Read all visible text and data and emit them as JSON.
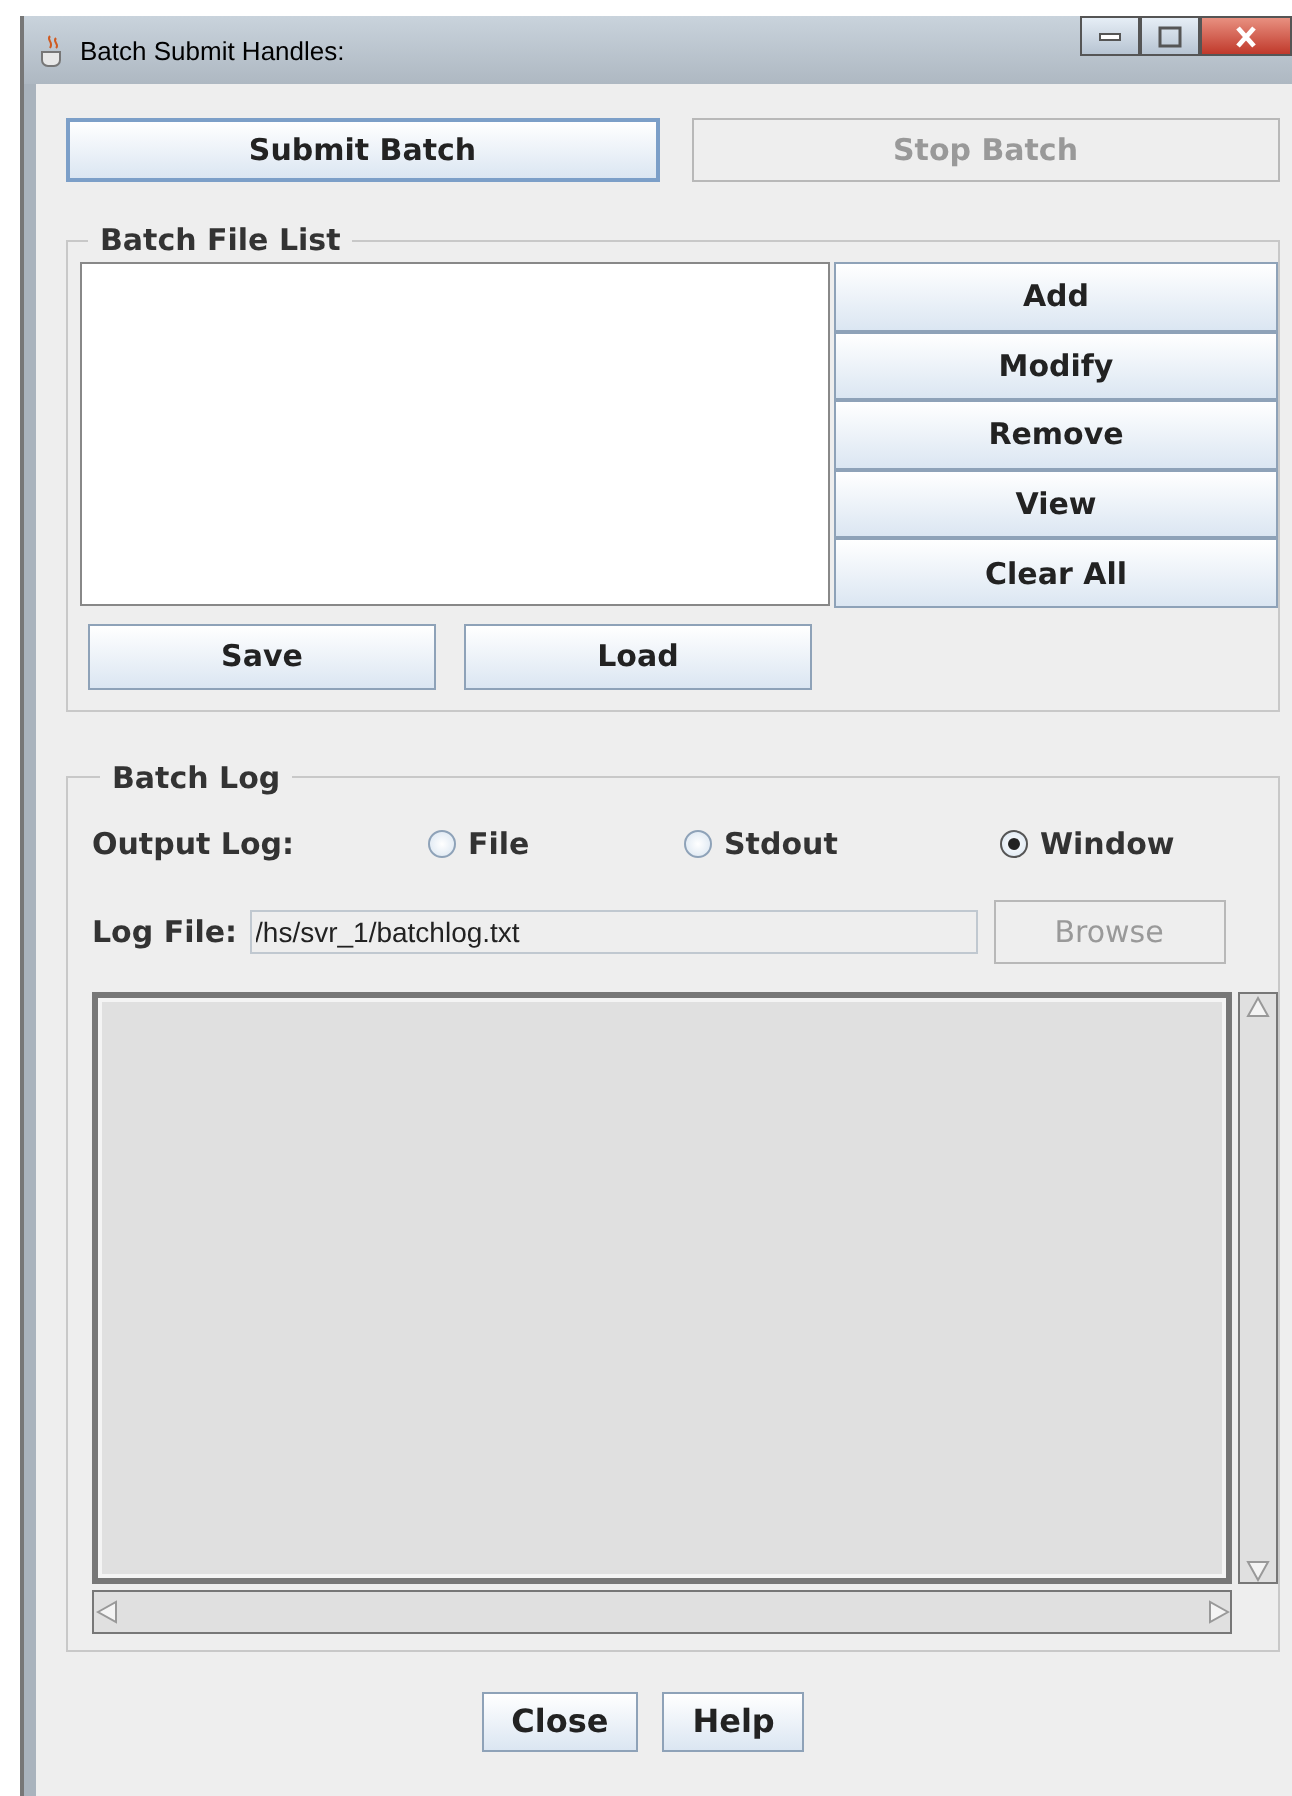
{
  "window": {
    "title": "Batch Submit Handles:"
  },
  "top_buttons": [
    {
      "label": "Submit Batch",
      "disabled": false,
      "focused": true
    },
    {
      "label": "Stop Batch",
      "disabled": true,
      "focused": false
    }
  ],
  "batch_file_list": {
    "title": "Batch File List",
    "side_buttons": [
      "Add",
      "Modify",
      "Remove",
      "View",
      "Clear All"
    ],
    "bottom_buttons": [
      "Save",
      "Load"
    ]
  },
  "batch_log": {
    "title": "Batch Log",
    "output_label": "Output Log:",
    "options": [
      {
        "label": "File",
        "selected": false
      },
      {
        "label": "Stdout",
        "selected": false
      },
      {
        "label": "Window",
        "selected": true
      }
    ],
    "log_file_label": "Log File:",
    "log_file_value": "/hs/svr_1/batchlog.txt",
    "browse": {
      "label": "Browse",
      "disabled": true
    }
  },
  "footer_buttons": [
    "Close",
    "Help"
  ]
}
